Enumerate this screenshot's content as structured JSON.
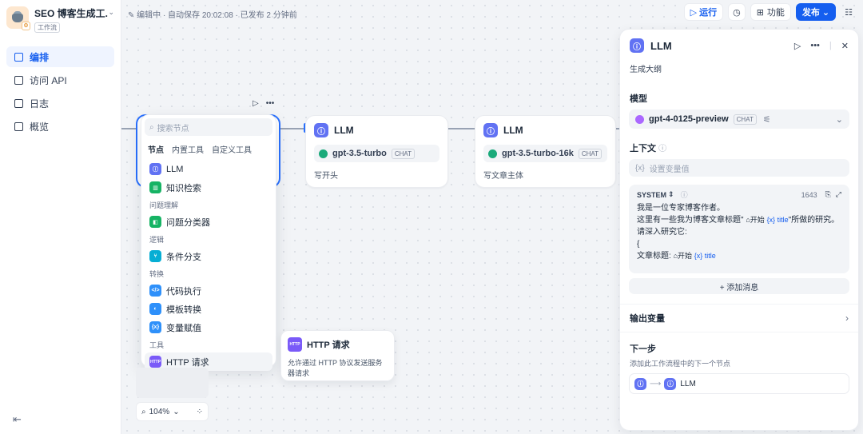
{
  "sidebar": {
    "app_name": "SEO 博客生成工...",
    "app_type": "工作流",
    "items": [
      {
        "label": "编排"
      },
      {
        "label": "访问 API"
      },
      {
        "label": "日志"
      },
      {
        "label": "概览"
      }
    ],
    "collapse_icon": "⇤"
  },
  "topbar": {
    "status": "编辑中 · 自动保存 20:02:08 · 已发布 2 分钟前",
    "run_label": "运行",
    "features_label": "功能",
    "publish_label": "发布"
  },
  "nodes": [
    {
      "title": "LLM",
      "model": "gpt-3.5-turbo",
      "mode": "CHAT",
      "desc": "写开头"
    },
    {
      "title": "LLM",
      "model": "gpt-3.5-turbo-16k",
      "mode": "CHAT",
      "desc": "写文章主体"
    }
  ],
  "popup": {
    "search_placeholder": "搜索节点",
    "tabs": [
      "节点",
      "内置工具",
      "自定义工具"
    ],
    "items": [
      {
        "label": "LLM",
        "color": "#6172f3"
      },
      {
        "label": "知识检索",
        "color": "#16b364"
      },
      {
        "category": "问题理解"
      },
      {
        "label": "问题分类器",
        "color": "#16b364"
      },
      {
        "category": "逻辑"
      },
      {
        "label": "条件分支",
        "color": "#06aed4"
      },
      {
        "category": "转换"
      },
      {
        "label": "代码执行",
        "color": "#2e90fa"
      },
      {
        "label": "模板转换",
        "color": "#2e90fa"
      },
      {
        "label": "变量赋值",
        "color": "#2e90fa"
      },
      {
        "category": "工具"
      },
      {
        "label": "HTTP 请求",
        "color": "#7a5af8"
      }
    ]
  },
  "http_tip": {
    "title": "HTTP 请求",
    "desc": "允许通过 HTTP 协议发送服务器请求"
  },
  "zoom": "104%",
  "panel": {
    "title": "LLM",
    "subtitle": "生成大纲",
    "model_label": "模型",
    "model": "gpt-4-0125-preview",
    "model_mode": "CHAT",
    "context_label": "上下文",
    "context_placeholder": "设置变量值",
    "prompt_role": "SYSTEM",
    "prompt_count": "1643",
    "prompt_lines": {
      "l1": "我是一位专家博客作者。",
      "l2a": "这里有一些我为博客文章标题\"",
      "start": "开始",
      "var": "{x} title",
      "l2b": "\"所做的研究。",
      "l3": "请深入研究它:",
      "l4": "{",
      "l5": "文章标题:"
    },
    "add_message": "+ 添加消息",
    "output_label": "输出变量",
    "next_label": "下一步",
    "next_desc": "添加此工作流程中的下一个节点",
    "next_node": "LLM"
  }
}
